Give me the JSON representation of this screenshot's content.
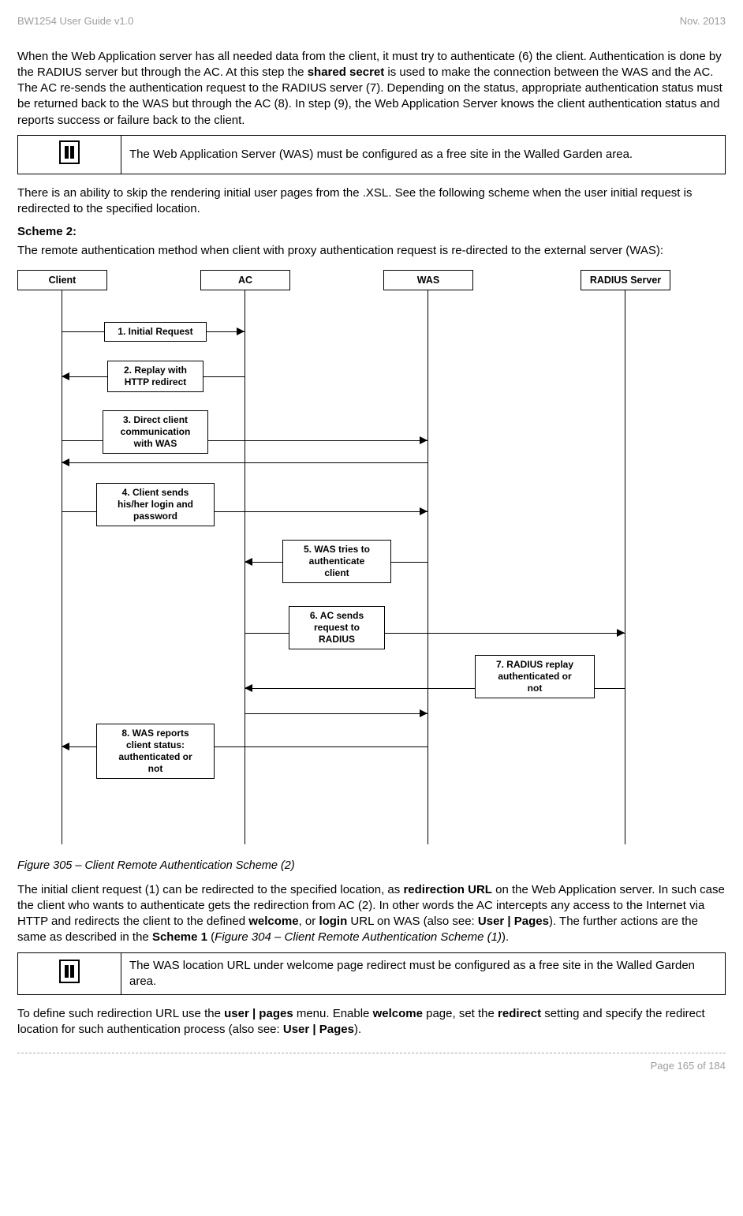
{
  "header": {
    "left": "BW1254 User Guide v1.0",
    "right": "Nov.  2013"
  },
  "para1_pre": "When the Web Application server has all needed data from the client, it must try to authenticate (6) the client. Authentication is done by the RADIUS server but through the AC. At this step the ",
  "para1_bold1": "shared secret",
  "para1_post1": " is used to make the connection between the WAS and the AC. The AC re-sends the authentication request to the RADIUS server (7). Depending on the status, appropriate authentication status must be returned back to the WAS but through the AC (8).  In step (9), the Web Application Server knows the client authentication status and reports success or failure back to the client.",
  "infobox1": "The Web Application Server (WAS) must be configured as a free site in the Walled Garden area.",
  "para2": "There is an ability to skip the rendering initial user pages from the .XSL. See the following scheme when the user initial request is redirected to the specified location.",
  "scheme2": "Scheme 2:",
  "para3": "The remote authentication method when client with proxy authentication request is re-directed to the external server (WAS):",
  "actors": {
    "client": "Client",
    "ac": "AC",
    "was": "WAS",
    "radius": "RADIUS Server"
  },
  "msgs": {
    "m1": "1. Initial Request",
    "m2a": "2. Replay with",
    "m2b": "HTTP redirect",
    "m3a": "3. Direct client",
    "m3b": "communication",
    "m3c": "with WAS",
    "m4a": "4. Client sends",
    "m4b": "his/her login and",
    "m4c": "password",
    "m5a": "5. WAS tries to",
    "m5b": "authenticate",
    "m5c": "client",
    "m6a": "6. AC sends",
    "m6b": "request to",
    "m6c": "RADIUS",
    "m7a": "7. RADIUS replay",
    "m7b": "authenticated or",
    "m7c": "not",
    "m8a": "8. WAS reports",
    "m8b": "client status:",
    "m8c": "authenticated or",
    "m8d": "not"
  },
  "caption": "Figure 305  – Client Remote Authentication Scheme (2)",
  "para4_pre": "The initial client request (1) can be redirected to the specified location, as ",
  "para4_b1": "redirection URL",
  "para4_mid1": " on the Web Application server. In such case the client who wants to authenticate gets the redirection from AC (2). In other words the AC intercepts any access to the Internet via HTTP and redirects the client to the defined ",
  "para4_b2": "welcome",
  "para4_mid2": ", or ",
  "para4_b3": "login",
  "para4_mid3": " URL on WAS (also see: ",
  "para4_b4": "User | Pages",
  "para4_mid4": "). The further actions are the same as described in the ",
  "para4_b5": "Scheme 1",
  "para4_mid5": " (",
  "para4_i1": "Figure 304  – Client Remote Authentication Scheme (1)",
  "para4_end": ").",
  "infobox2": "The WAS location URL under welcome page redirect must be configured as a free site in the Walled Garden area.",
  "para5_pre": "To define such redirection URL use the ",
  "para5_b1": "user | pages",
  "para5_mid1": " menu. Enable ",
  "para5_b2": "welcome",
  "para5_mid2": " page, set the ",
  "para5_b3": "redirect",
  "para5_mid3": " setting and specify the redirect location for such authentication process (also see: ",
  "para5_b4": "User | Pages",
  "para5_end": ").",
  "footer": "Page 165 of 184"
}
